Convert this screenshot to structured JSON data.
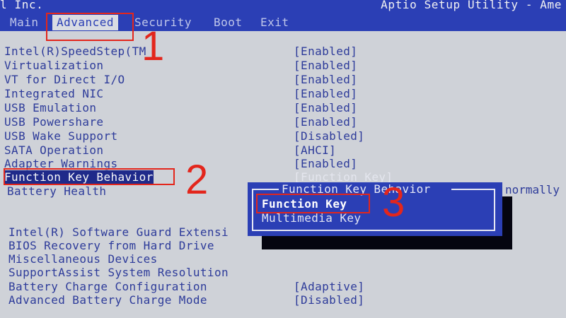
{
  "header": {
    "vendor": "l Inc.",
    "title": "Aptio Setup Utility - Ame"
  },
  "tabs": [
    {
      "label": "Main",
      "active": false
    },
    {
      "label": "Advanced",
      "active": true
    },
    {
      "label": "Security",
      "active": false
    },
    {
      "label": "Boot",
      "active": false
    },
    {
      "label": "Exit",
      "active": false
    }
  ],
  "settings": [
    {
      "label": "Intel(R)SpeedStep(TM",
      "value": "[Enabled]"
    },
    {
      "label": "Virtualization",
      "value": "[Enabled]"
    },
    {
      "label": "VT for Direct I/O",
      "value": "[Enabled]"
    },
    {
      "label": "Integrated NIC",
      "value": "[Enabled]"
    },
    {
      "label": "USB Emulation",
      "value": "[Enabled]"
    },
    {
      "label": "USB Powershare",
      "value": "[Enabled]"
    },
    {
      "label": "USB Wake Support",
      "value": "[Disabled]"
    },
    {
      "label": "SATA Operation",
      "value": "[AHCI]"
    },
    {
      "label": "Adapter Warnings",
      "value": "[Enabled]"
    },
    {
      "label": "Function Key Behavior",
      "value": "[Function Key]"
    },
    {
      "label": "Battery Health",
      "value": "normally"
    },
    {
      "label": "Intel(R) Software Guard Extensi",
      "value": ""
    },
    {
      "label": "BIOS Recovery from Hard Drive",
      "value": ""
    },
    {
      "label": "Miscellaneous Devices",
      "value": ""
    },
    {
      "label": "SupportAssist System Resolution",
      "value": ""
    },
    {
      "label": "Battery Charge Configuration",
      "value": "[Adaptive]"
    },
    {
      "label": "Advanced Battery Charge Mode",
      "value": "[Disabled]"
    }
  ],
  "popup": {
    "title": "Function Key Behavior",
    "options": [
      "Function Key",
      "Multimedia Key"
    ],
    "selected": "Function Key"
  },
  "callouts": [
    "1",
    "2",
    "3"
  ],
  "colors": {
    "bios_blue": "#2b3fb5",
    "panel_gray": "#cfd2d8",
    "callout_red": "#e3261c"
  }
}
